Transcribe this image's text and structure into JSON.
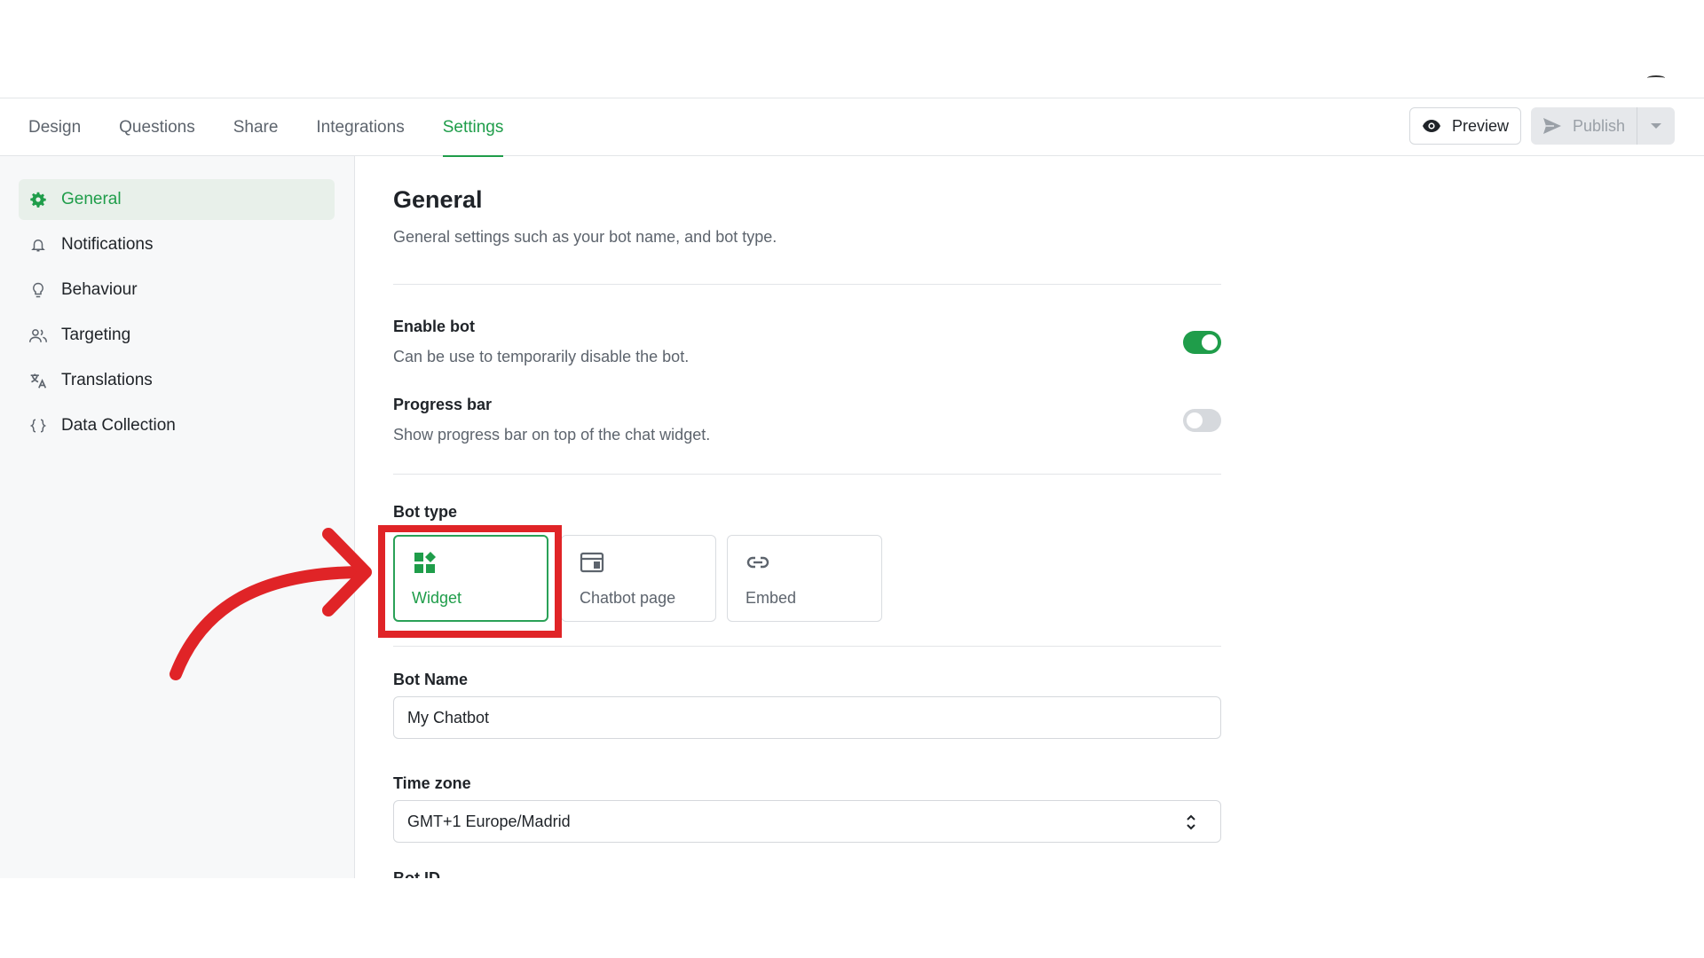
{
  "tabs": [
    {
      "label": "Design"
    },
    {
      "label": "Questions"
    },
    {
      "label": "Share"
    },
    {
      "label": "Integrations"
    },
    {
      "label": "Settings"
    }
  ],
  "active_tab": "Settings",
  "header": {
    "preview_label": "Preview",
    "publish_label": "Publish"
  },
  "sidebar": {
    "items": [
      {
        "label": "General",
        "icon": "gear-icon"
      },
      {
        "label": "Notifications",
        "icon": "bell-icon"
      },
      {
        "label": "Behaviour",
        "icon": "lightbulb-icon"
      },
      {
        "label": "Targeting",
        "icon": "users-icon"
      },
      {
        "label": "Translations",
        "icon": "translate-icon"
      },
      {
        "label": "Data Collection",
        "icon": "braces-icon"
      }
    ],
    "active": "General"
  },
  "main": {
    "title": "General",
    "subtitle": "General settings such as your bot name, and bot type.",
    "enable_bot": {
      "label": "Enable bot",
      "description": "Can be use to temporarily disable the bot.",
      "on": true
    },
    "progress_bar": {
      "label": "Progress bar",
      "description": "Show progress bar on top of the chat widget.",
      "on": false
    },
    "bot_type": {
      "label": "Bot type",
      "options": [
        {
          "label": "Widget",
          "icon": "widget-icon"
        },
        {
          "label": "Chatbot page",
          "icon": "browser-window-icon"
        },
        {
          "label": "Embed",
          "icon": "link-icon"
        }
      ],
      "selected": "Widget"
    },
    "bot_name": {
      "label": "Bot Name",
      "value": "My Chatbot"
    },
    "time_zone": {
      "label": "Time zone",
      "value": "GMT+1 Europe/Madrid"
    },
    "bot_id": {
      "label": "Bot ID"
    }
  },
  "colors": {
    "accent": "#1f9d4a",
    "highlight": "#e02427"
  }
}
